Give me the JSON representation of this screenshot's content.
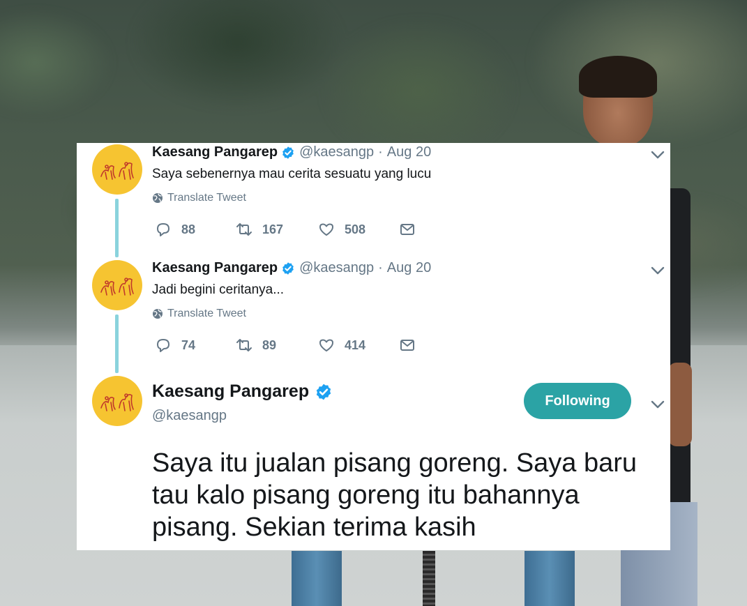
{
  "tweets": [
    {
      "name": "Kaesang Pangarep",
      "handle": "@kaesangp",
      "separator": "·",
      "date": "Aug 20",
      "text": "Saya sebenernya mau cerita sesuatu yang lucu",
      "translate_label": "Translate Tweet",
      "replies": "88",
      "retweets": "167",
      "likes": "508"
    },
    {
      "name": "Kaesang Pangarep",
      "handle": "@kaesangp",
      "separator": "·",
      "date": "Aug 20",
      "text": "Jadi begini ceritanya...",
      "translate_label": "Translate Tweet",
      "replies": "74",
      "retweets": "89",
      "likes": "414"
    }
  ],
  "main_tweet": {
    "name": "Kaesang Pangarep",
    "handle": "@kaesangp",
    "follow_label": "Following",
    "text": "Saya itu jualan pisang goreng. Saya baru tau kalo pisang goreng itu bahannya pisang. Sekian terima kasih"
  },
  "colors": {
    "avatar_bg": "#f6c431",
    "verified_badge": "#1da1f2",
    "thread_line": "#8ad3dd",
    "following_button": "#2ba3a5",
    "secondary_text": "#657786",
    "primary_text": "#14171a"
  },
  "icons": {
    "avatar": "avatar-illustration",
    "verified": "verified-badge-icon",
    "caret": "chevron-down-icon",
    "translate": "globe-icon",
    "reply": "reply-icon",
    "retweet": "retweet-icon",
    "like": "heart-icon",
    "direct_message": "envelope-icon"
  }
}
